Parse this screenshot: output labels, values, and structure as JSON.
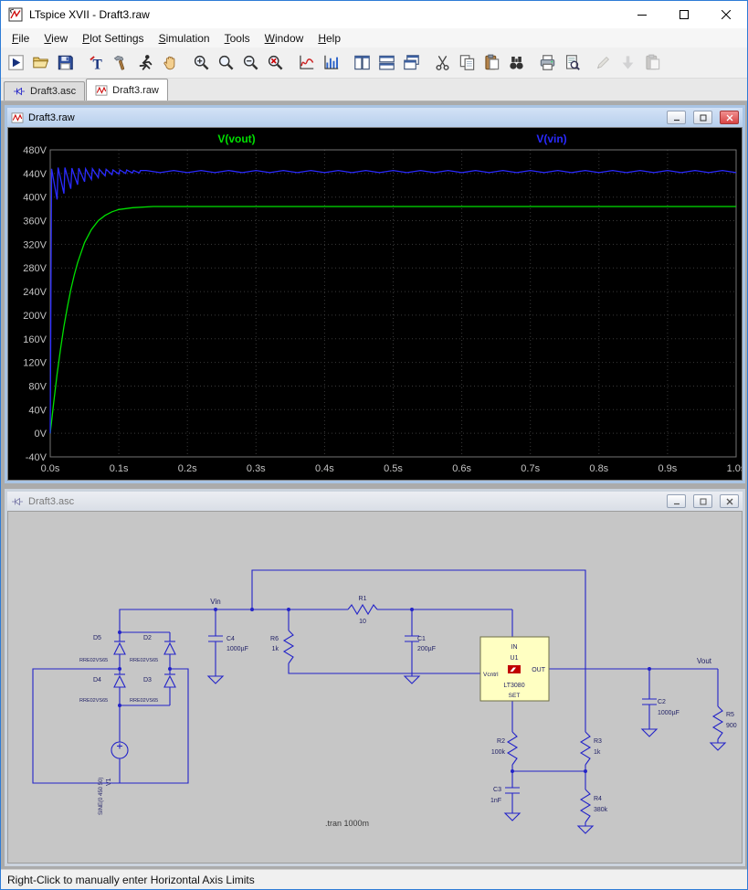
{
  "window": {
    "title": "LTspice XVII - Draft3.raw"
  },
  "menu": {
    "items": [
      "File",
      "View",
      "Plot Settings",
      "Simulation",
      "Tools",
      "Window",
      "Help"
    ]
  },
  "toolbar": {
    "icons": [
      "run",
      "open",
      "save",
      "probe",
      "control-panel",
      "halt",
      "pan",
      "zoom-in",
      "zoom-extents",
      "zoom-out",
      "zoom-full",
      "autorange",
      "plot-settings",
      "tile-vertical",
      "tile-horizontal",
      "cascade",
      "cut",
      "copy",
      "paste",
      "find",
      "print",
      "print-preview",
      "edit",
      "export",
      "paste-special"
    ]
  },
  "tabs": [
    {
      "label": "Draft3.asc"
    },
    {
      "label": "Draft3.raw"
    }
  ],
  "raw_window": {
    "title": "Draft3.raw"
  },
  "asc_window": {
    "title": "Draft3.asc"
  },
  "status_bar": {
    "text": "Right-Click to manually enter Horizontal Axis Limits"
  },
  "colors": {
    "trace_vout": "#00e000",
    "trace_vin": "#2a2aff",
    "wire": "#2323c8",
    "symbol_fill": "#ffffc2",
    "close_button": "#d84444"
  },
  "chart_data": {
    "type": "line",
    "title": "",
    "xlim": [
      0,
      1
    ],
    "ylim": [
      -40,
      480
    ],
    "xticks": [
      0,
      0.1,
      0.2,
      0.3,
      0.4,
      0.5,
      0.6,
      0.7,
      0.8,
      0.9,
      1
    ],
    "xtick_labels": [
      "0.0s",
      "0.1s",
      "0.2s",
      "0.3s",
      "0.4s",
      "0.5s",
      "0.6s",
      "0.7s",
      "0.8s",
      "0.9s",
      "1.0s"
    ],
    "yticks": [
      480,
      440,
      400,
      360,
      320,
      280,
      240,
      200,
      160,
      120,
      80,
      40,
      0,
      -40
    ],
    "ytick_labels": [
      "480V",
      "440V",
      "400V",
      "360V",
      "320V",
      "280V",
      "240V",
      "200V",
      "160V",
      "120V",
      "80V",
      "40V",
      "0V",
      "-40V"
    ],
    "grid": true,
    "background": "#000000",
    "legend_position": "top",
    "series": [
      {
        "name": "V(vout)",
        "color": "#00e000",
        "points": [
          [
            0,
            0
          ],
          [
            0.005,
            52
          ],
          [
            0.01,
            100
          ],
          [
            0.015,
            143
          ],
          [
            0.02,
            181
          ],
          [
            0.025,
            214
          ],
          [
            0.03,
            243
          ],
          [
            0.035,
            268
          ],
          [
            0.04,
            289
          ],
          [
            0.05,
            323
          ],
          [
            0.06,
            345
          ],
          [
            0.07,
            360
          ],
          [
            0.08,
            369
          ],
          [
            0.09,
            375
          ],
          [
            0.1,
            379
          ],
          [
            0.12,
            382
          ],
          [
            0.15,
            384
          ],
          [
            0.2,
            384
          ],
          [
            0.3,
            384
          ],
          [
            0.5,
            384
          ],
          [
            0.75,
            384
          ],
          [
            1,
            384
          ]
        ]
      },
      {
        "name": "V(vin)",
        "color": "#2a2aff",
        "points": [
          [
            0,
            0
          ],
          [
            0.002,
            448
          ],
          [
            0.01,
            396
          ],
          [
            0.0115,
            450
          ],
          [
            0.02,
            406
          ],
          [
            0.0215,
            450
          ],
          [
            0.03,
            414
          ],
          [
            0.0315,
            449
          ],
          [
            0.04,
            421
          ],
          [
            0.0415,
            449
          ],
          [
            0.05,
            426
          ],
          [
            0.0515,
            448
          ],
          [
            0.06,
            430
          ],
          [
            0.0615,
            448
          ],
          [
            0.07,
            433
          ],
          [
            0.0715,
            447
          ],
          [
            0.08,
            436
          ],
          [
            0.0815,
            447
          ],
          [
            0.09,
            438
          ],
          [
            0.0915,
            446
          ],
          [
            0.1,
            439
          ],
          [
            0.1015,
            446
          ],
          [
            0.11,
            440
          ],
          [
            0.1115,
            446
          ],
          [
            0.12,
            441
          ],
          [
            0.1215,
            445
          ],
          [
            0.13,
            441
          ],
          [
            0.1315,
            445
          ],
          [
            0.14,
            445
          ],
          [
            0.16,
            441.5
          ],
          [
            0.18,
            445
          ],
          [
            0.2,
            441.5
          ],
          [
            0.22,
            445
          ],
          [
            0.24,
            441.5
          ],
          [
            0.26,
            445
          ],
          [
            0.28,
            441.5
          ],
          [
            0.3,
            445
          ],
          [
            0.32,
            441.5
          ],
          [
            0.34,
            445
          ],
          [
            0.36,
            441.5
          ],
          [
            0.38,
            445
          ],
          [
            0.4,
            441.5
          ],
          [
            0.42,
            445
          ],
          [
            0.44,
            441.5
          ],
          [
            0.46,
            445
          ],
          [
            0.48,
            441.5
          ],
          [
            0.5,
            445
          ],
          [
            0.52,
            441.5
          ],
          [
            0.54,
            445
          ],
          [
            0.56,
            441.5
          ],
          [
            0.58,
            445
          ],
          [
            0.6,
            441.5
          ],
          [
            0.62,
            445
          ],
          [
            0.64,
            441.5
          ],
          [
            0.66,
            445
          ],
          [
            0.68,
            441.5
          ],
          [
            0.7,
            445
          ],
          [
            0.72,
            441.5
          ],
          [
            0.74,
            445
          ],
          [
            0.76,
            441.5
          ],
          [
            0.78,
            445
          ],
          [
            0.8,
            441.5
          ],
          [
            0.82,
            445
          ],
          [
            0.84,
            441.5
          ],
          [
            0.86,
            445
          ],
          [
            0.88,
            441.5
          ],
          [
            0.9,
            445
          ],
          [
            0.92,
            441.5
          ],
          [
            0.94,
            445
          ],
          [
            0.96,
            441.5
          ],
          [
            0.98,
            445
          ],
          [
            1,
            441.5
          ]
        ]
      }
    ]
  },
  "schematic": {
    "net_labels": {
      "vin": "Vin",
      "vout": "Vout"
    },
    "directive": ".tran 1000m",
    "components": {
      "d5": {
        "name": "D5",
        "value": "RRE02VS65"
      },
      "d2": {
        "name": "D2",
        "value": "RRE02VS65"
      },
      "d4": {
        "name": "D4",
        "value": "RRE02VS65"
      },
      "d3": {
        "name": "D3",
        "value": "RRE02VS65"
      },
      "v1": {
        "name": "V1",
        "value": "SINE(0 450 50)"
      },
      "c4": {
        "name": "C4",
        "value": "1000µF"
      },
      "r6": {
        "name": "R6",
        "value": "1k"
      },
      "r1": {
        "name": "R1",
        "value": "10"
      },
      "c1": {
        "name": "C1",
        "value": "200µF"
      },
      "u1": {
        "name": "U1",
        "value": "LT3080",
        "pins": {
          "in": "IN",
          "out": "OUT",
          "vcntrl": "Vcntrl",
          "set": "SET"
        }
      },
      "r2": {
        "name": "R2",
        "value": "100k"
      },
      "c3": {
        "name": "C3",
        "value": "1nF"
      },
      "r3": {
        "name": "R3",
        "value": "1k"
      },
      "r4": {
        "name": "R4",
        "value": "380k"
      },
      "c2": {
        "name": "C2",
        "value": "1000µF"
      },
      "r5": {
        "name": "R5",
        "value": "900"
      }
    }
  }
}
